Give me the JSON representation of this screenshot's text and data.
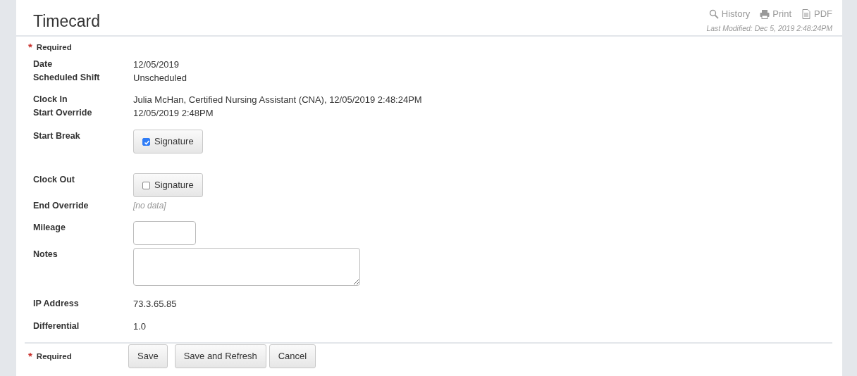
{
  "title": "Timecard",
  "actions": [
    {
      "kind": "search",
      "label": "History"
    },
    {
      "kind": "print",
      "label": "Print"
    },
    {
      "kind": "document",
      "label": "PDF"
    }
  ],
  "last_modified": "Last Modified: Dec 5, 2019 2:48:24PM",
  "required_note": {
    "mark": "*",
    "label": "Required"
  },
  "rows": [
    {
      "kind": "text",
      "label": "Date",
      "value": "12/05/2019"
    },
    {
      "kind": "text",
      "label": "Scheduled Shift",
      "value": "Unscheduled"
    },
    {
      "kind": "text",
      "label": "Clock In",
      "value": "Julia McHan, Certified Nursing Assistant (CNA), 12/05/2019 2:48:24PM"
    },
    {
      "kind": "text",
      "label": "Start Override",
      "value": "12/05/2019 2:48PM"
    },
    {
      "kind": "signature",
      "label": "Start Break",
      "button": "Signature",
      "checked": true
    },
    {
      "kind": "signature",
      "label": "Clock Out",
      "button": "Signature",
      "checked": false
    },
    {
      "kind": "empty",
      "label": "End Override",
      "value": "[no data]"
    },
    {
      "kind": "input",
      "label": "Mileage"
    },
    {
      "kind": "textarea",
      "label": "Notes"
    },
    {
      "kind": "text",
      "label": "IP Address",
      "value": "73.3.65.85"
    },
    {
      "kind": "text",
      "label": "Differential",
      "value": "1.0"
    }
  ],
  "footer": {
    "mark": "*",
    "label": "Required",
    "buttons": [
      "Save",
      "Save and Refresh",
      "Cancel"
    ]
  }
}
